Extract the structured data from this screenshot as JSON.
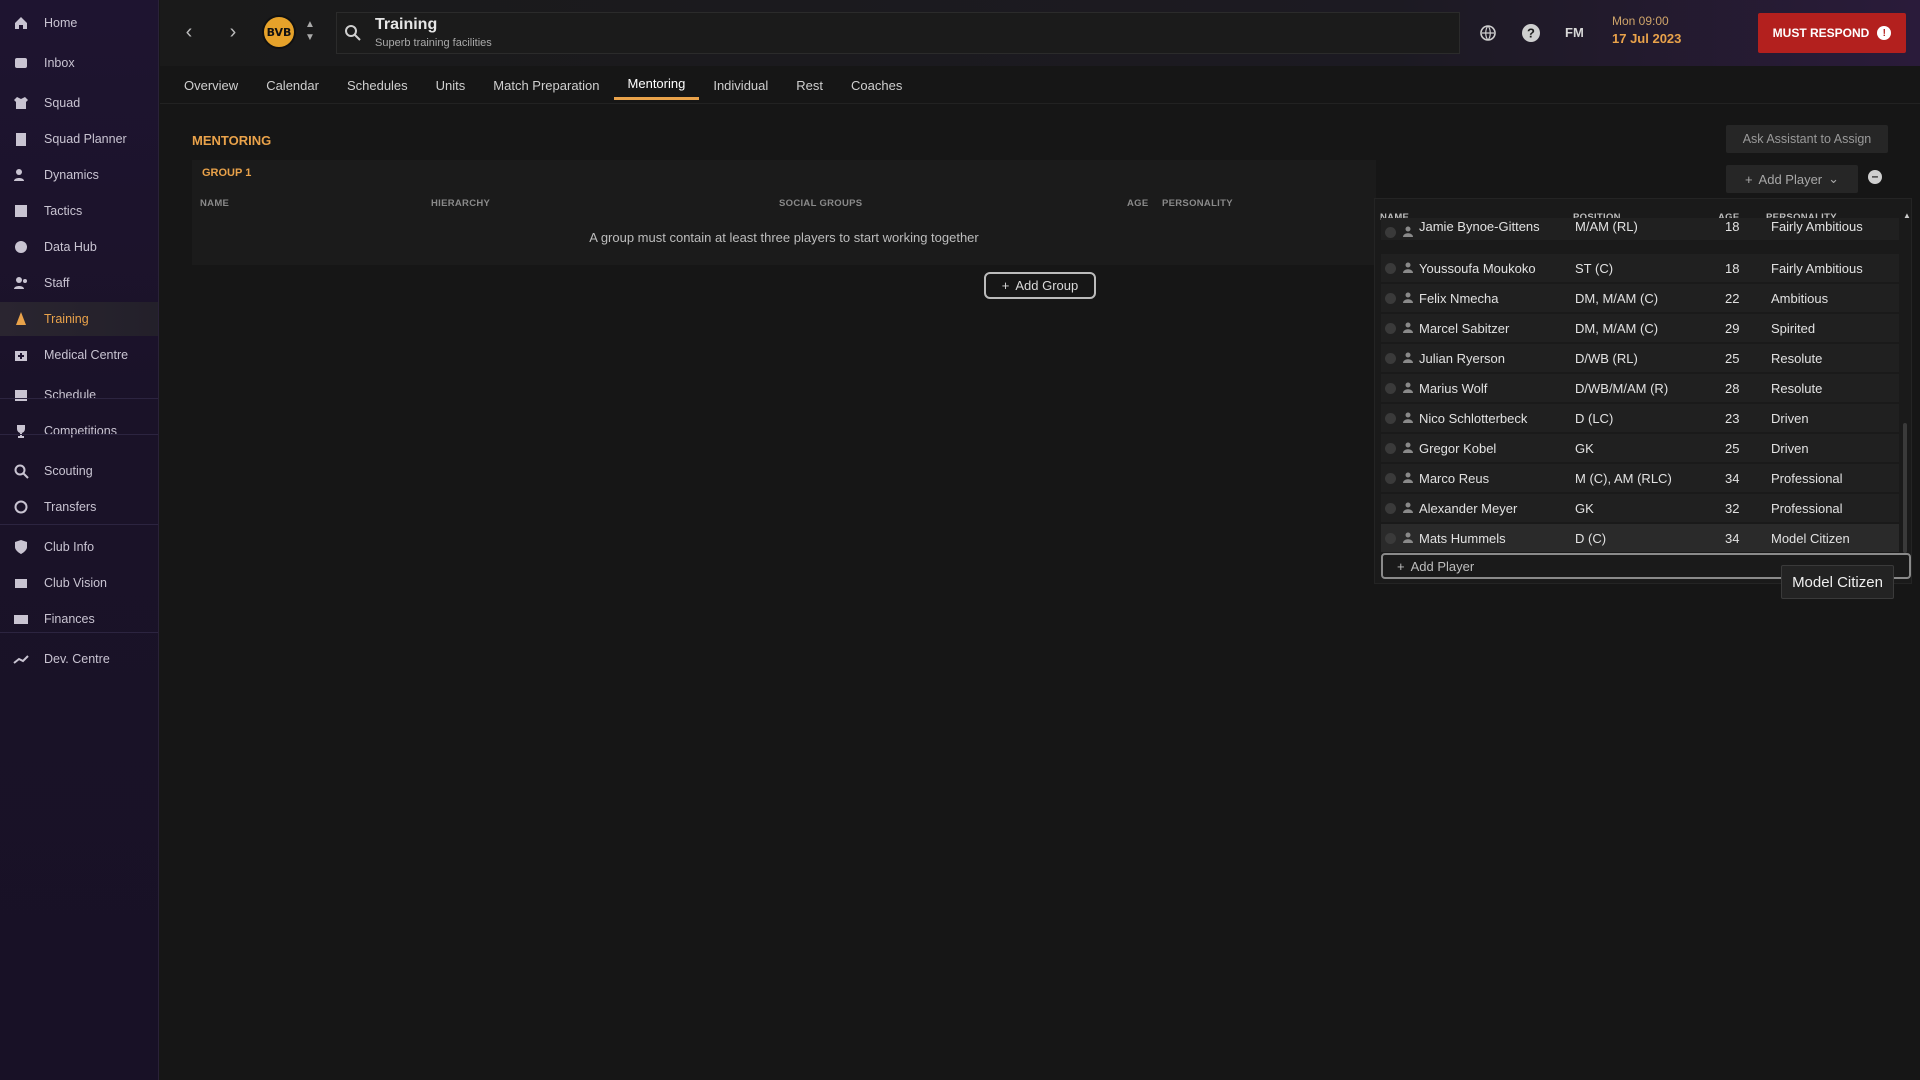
{
  "sidebar": {
    "items": [
      {
        "label": "Home",
        "icon": "home-icon"
      },
      {
        "label": "Inbox",
        "icon": "inbox-icon"
      },
      {
        "label": "Squad",
        "icon": "shirt-icon"
      },
      {
        "label": "Squad Planner",
        "icon": "clipboard-icon"
      },
      {
        "label": "Dynamics",
        "icon": "people-icon"
      },
      {
        "label": "Tactics",
        "icon": "tactics-board-icon"
      },
      {
        "label": "Data Hub",
        "icon": "data-circle-icon"
      },
      {
        "label": "Staff",
        "icon": "staff-icon"
      },
      {
        "label": "Training",
        "icon": "cone-icon"
      },
      {
        "label": "Medical Centre",
        "icon": "medical-icon"
      },
      {
        "label": "Schedule",
        "icon": "calendar-icon"
      },
      {
        "label": "Competitions",
        "icon": "trophy-icon"
      },
      {
        "label": "Scouting",
        "icon": "magnifier-icon"
      },
      {
        "label": "Transfers",
        "icon": "swap-icon"
      },
      {
        "label": "Club Info",
        "icon": "shield-icon"
      },
      {
        "label": "Club Vision",
        "icon": "vision-icon"
      },
      {
        "label": "Finances",
        "icon": "money-icon"
      },
      {
        "label": "Dev. Centre",
        "icon": "dev-centre-icon"
      }
    ],
    "active": "Training"
  },
  "header": {
    "title": "Training",
    "subtitle": "Superb training facilities",
    "club_badge_text": "BVB",
    "fm_label": "FM",
    "time": "Mon 09:00",
    "date": "17 Jul 2023",
    "must_respond": "MUST RESPOND",
    "must_respond_mark": "!"
  },
  "tabs": [
    "Overview",
    "Calendar",
    "Schedules",
    "Units",
    "Match Preparation",
    "Mentoring",
    "Individual",
    "Rest",
    "Coaches"
  ],
  "active_tab": "Mentoring",
  "main": {
    "section_title": "MENTORING",
    "ask_assistant": "Ask Assistant to Assign",
    "add_player_top": "Add Player",
    "group": {
      "title": "GROUP 1",
      "columns": [
        "NAME",
        "HIERARCHY",
        "SOCIAL GROUPS",
        "AGE",
        "PERSONALITY"
      ],
      "message": "A group must contain at least three players to start working together"
    },
    "add_group": "Add Group"
  },
  "dropdown": {
    "columns": [
      "NAME",
      "POSITION",
      "AGE",
      "PERSONALITY"
    ],
    "rows": [
      {
        "name": "Jamie Bynoe-Gittens",
        "position": "M/AM (RL)",
        "age": "18",
        "personality": "Fairly Ambitious"
      },
      {
        "name": "Youssoufa Moukoko",
        "position": "ST (C)",
        "age": "18",
        "personality": "Fairly Ambitious"
      },
      {
        "name": "Felix Nmecha",
        "position": "DM, M/AM (C)",
        "age": "22",
        "personality": "Ambitious"
      },
      {
        "name": "Marcel Sabitzer",
        "position": "DM, M/AM (C)",
        "age": "29",
        "personality": "Spirited"
      },
      {
        "name": "Julian Ryerson",
        "position": "D/WB (RL)",
        "age": "25",
        "personality": "Resolute"
      },
      {
        "name": "Marius Wolf",
        "position": "D/WB/M/AM (R)",
        "age": "28",
        "personality": "Resolute"
      },
      {
        "name": "Nico Schlotterbeck",
        "position": "D (LC)",
        "age": "23",
        "personality": "Driven"
      },
      {
        "name": "Gregor Kobel",
        "position": "GK",
        "age": "25",
        "personality": "Driven"
      },
      {
        "name": "Marco Reus",
        "position": "M (C), AM (RLC)",
        "age": "34",
        "personality": "Professional"
      },
      {
        "name": "Alexander Meyer",
        "position": "GK",
        "age": "32",
        "personality": "Professional"
      },
      {
        "name": "Mats Hummels",
        "position": "D (C)",
        "age": "34",
        "personality": "Model Citizen"
      }
    ],
    "add_player": "Add Player"
  },
  "tooltip": "Model Citizen",
  "colors": {
    "accent": "#e9a24a",
    "must_respond": "#b3201e",
    "sidebar": "#1e1430"
  }
}
